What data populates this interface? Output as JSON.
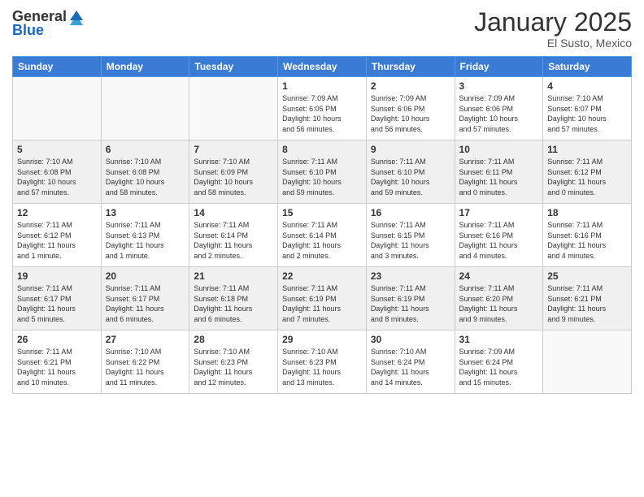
{
  "header": {
    "logo_general": "General",
    "logo_blue": "Blue",
    "title": "January 2025",
    "location": "El Susto, Mexico"
  },
  "weekdays": [
    "Sunday",
    "Monday",
    "Tuesday",
    "Wednesday",
    "Thursday",
    "Friday",
    "Saturday"
  ],
  "weeks": [
    [
      {
        "day": "",
        "info": ""
      },
      {
        "day": "",
        "info": ""
      },
      {
        "day": "",
        "info": ""
      },
      {
        "day": "1",
        "info": "Sunrise: 7:09 AM\nSunset: 6:05 PM\nDaylight: 10 hours\nand 56 minutes."
      },
      {
        "day": "2",
        "info": "Sunrise: 7:09 AM\nSunset: 6:06 PM\nDaylight: 10 hours\nand 56 minutes."
      },
      {
        "day": "3",
        "info": "Sunrise: 7:09 AM\nSunset: 6:06 PM\nDaylight: 10 hours\nand 57 minutes."
      },
      {
        "day": "4",
        "info": "Sunrise: 7:10 AM\nSunset: 6:07 PM\nDaylight: 10 hours\nand 57 minutes."
      }
    ],
    [
      {
        "day": "5",
        "info": "Sunrise: 7:10 AM\nSunset: 6:08 PM\nDaylight: 10 hours\nand 57 minutes."
      },
      {
        "day": "6",
        "info": "Sunrise: 7:10 AM\nSunset: 6:08 PM\nDaylight: 10 hours\nand 58 minutes."
      },
      {
        "day": "7",
        "info": "Sunrise: 7:10 AM\nSunset: 6:09 PM\nDaylight: 10 hours\nand 58 minutes."
      },
      {
        "day": "8",
        "info": "Sunrise: 7:11 AM\nSunset: 6:10 PM\nDaylight: 10 hours\nand 59 minutes."
      },
      {
        "day": "9",
        "info": "Sunrise: 7:11 AM\nSunset: 6:10 PM\nDaylight: 10 hours\nand 59 minutes."
      },
      {
        "day": "10",
        "info": "Sunrise: 7:11 AM\nSunset: 6:11 PM\nDaylight: 11 hours\nand 0 minutes."
      },
      {
        "day": "11",
        "info": "Sunrise: 7:11 AM\nSunset: 6:12 PM\nDaylight: 11 hours\nand 0 minutes."
      }
    ],
    [
      {
        "day": "12",
        "info": "Sunrise: 7:11 AM\nSunset: 6:12 PM\nDaylight: 11 hours\nand 1 minute."
      },
      {
        "day": "13",
        "info": "Sunrise: 7:11 AM\nSunset: 6:13 PM\nDaylight: 11 hours\nand 1 minute."
      },
      {
        "day": "14",
        "info": "Sunrise: 7:11 AM\nSunset: 6:14 PM\nDaylight: 11 hours\nand 2 minutes."
      },
      {
        "day": "15",
        "info": "Sunrise: 7:11 AM\nSunset: 6:14 PM\nDaylight: 11 hours\nand 2 minutes."
      },
      {
        "day": "16",
        "info": "Sunrise: 7:11 AM\nSunset: 6:15 PM\nDaylight: 11 hours\nand 3 minutes."
      },
      {
        "day": "17",
        "info": "Sunrise: 7:11 AM\nSunset: 6:16 PM\nDaylight: 11 hours\nand 4 minutes."
      },
      {
        "day": "18",
        "info": "Sunrise: 7:11 AM\nSunset: 6:16 PM\nDaylight: 11 hours\nand 4 minutes."
      }
    ],
    [
      {
        "day": "19",
        "info": "Sunrise: 7:11 AM\nSunset: 6:17 PM\nDaylight: 11 hours\nand 5 minutes."
      },
      {
        "day": "20",
        "info": "Sunrise: 7:11 AM\nSunset: 6:17 PM\nDaylight: 11 hours\nand 6 minutes."
      },
      {
        "day": "21",
        "info": "Sunrise: 7:11 AM\nSunset: 6:18 PM\nDaylight: 11 hours\nand 6 minutes."
      },
      {
        "day": "22",
        "info": "Sunrise: 7:11 AM\nSunset: 6:19 PM\nDaylight: 11 hours\nand 7 minutes."
      },
      {
        "day": "23",
        "info": "Sunrise: 7:11 AM\nSunset: 6:19 PM\nDaylight: 11 hours\nand 8 minutes."
      },
      {
        "day": "24",
        "info": "Sunrise: 7:11 AM\nSunset: 6:20 PM\nDaylight: 11 hours\nand 9 minutes."
      },
      {
        "day": "25",
        "info": "Sunrise: 7:11 AM\nSunset: 6:21 PM\nDaylight: 11 hours\nand 9 minutes."
      }
    ],
    [
      {
        "day": "26",
        "info": "Sunrise: 7:11 AM\nSunset: 6:21 PM\nDaylight: 11 hours\nand 10 minutes."
      },
      {
        "day": "27",
        "info": "Sunrise: 7:10 AM\nSunset: 6:22 PM\nDaylight: 11 hours\nand 11 minutes."
      },
      {
        "day": "28",
        "info": "Sunrise: 7:10 AM\nSunset: 6:23 PM\nDaylight: 11 hours\nand 12 minutes."
      },
      {
        "day": "29",
        "info": "Sunrise: 7:10 AM\nSunset: 6:23 PM\nDaylight: 11 hours\nand 13 minutes."
      },
      {
        "day": "30",
        "info": "Sunrise: 7:10 AM\nSunset: 6:24 PM\nDaylight: 11 hours\nand 14 minutes."
      },
      {
        "day": "31",
        "info": "Sunrise: 7:09 AM\nSunset: 6:24 PM\nDaylight: 11 hours\nand 15 minutes."
      },
      {
        "day": "",
        "info": ""
      }
    ]
  ]
}
